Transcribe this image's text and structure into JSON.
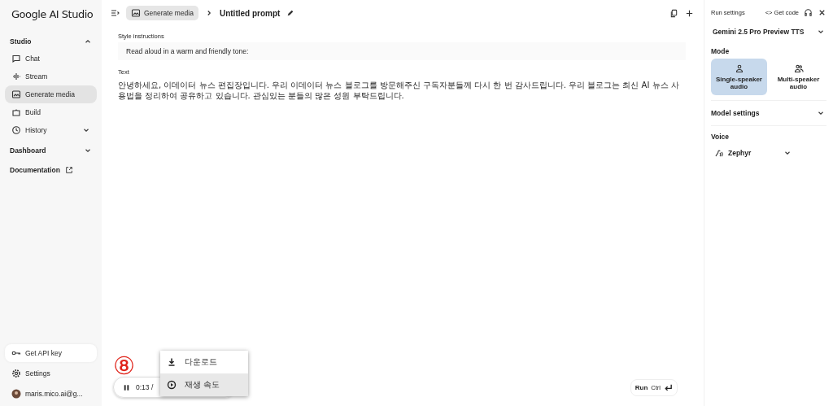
{
  "sidebar": {
    "logo": "Google AI Studio",
    "sections": [
      {
        "title": "Studio",
        "expanded": true,
        "items": [
          {
            "label": "Chat",
            "selected": false
          },
          {
            "label": "Stream",
            "selected": false
          },
          {
            "label": "Generate media",
            "selected": true
          },
          {
            "label": "Build",
            "selected": false
          },
          {
            "label": "History",
            "selected": false,
            "expandable": true
          }
        ]
      },
      {
        "title": "Dashboard",
        "expanded": false
      },
      {
        "title": "Documentation",
        "external": true
      }
    ],
    "footer": [
      {
        "label": "Get API key"
      },
      {
        "label": "Settings"
      },
      {
        "label": "maris.mico.ai@g..."
      }
    ]
  },
  "header": {
    "breadcrumb": "Generate media",
    "title": "Untitled prompt"
  },
  "style_instructions": {
    "label": "Style instructions",
    "value": "Read aloud in a warm and friendly tone:"
  },
  "text": {
    "label": "Text",
    "value": "안녕하세요, 이데이터 뉴스 편집장입니다. 우리 이데이터 뉴스 블로그를 방문해주신 구독자분들께 다시 한 번 감사드립니다. 우리 블로그는 최신 AI 뉴스 사용법을 정리하여 공유하고 있습니다. 관심있는 분들의 많은 성원 부탁드립니다."
  },
  "player": {
    "time": "0:13 /",
    "annotation": "⑧",
    "menu": [
      {
        "label": "다운로드",
        "selected": false
      },
      {
        "label": "재생 속도",
        "selected": true
      }
    ]
  },
  "run_button": {
    "label": "Run",
    "shortcut": "Ctrl"
  },
  "run_settings": {
    "title": "Run settings",
    "get_code": "Get code",
    "get_code_icon": "<>",
    "model": "Gemini 2.5 Pro Preview TTS",
    "mode_label": "Mode",
    "modes": [
      {
        "label": "Single-speaker audio",
        "selected": true
      },
      {
        "label": "Multi-speaker audio",
        "selected": false
      }
    ],
    "model_settings": "Model settings",
    "voice_label": "Voice",
    "voice": "Zephyr"
  }
}
